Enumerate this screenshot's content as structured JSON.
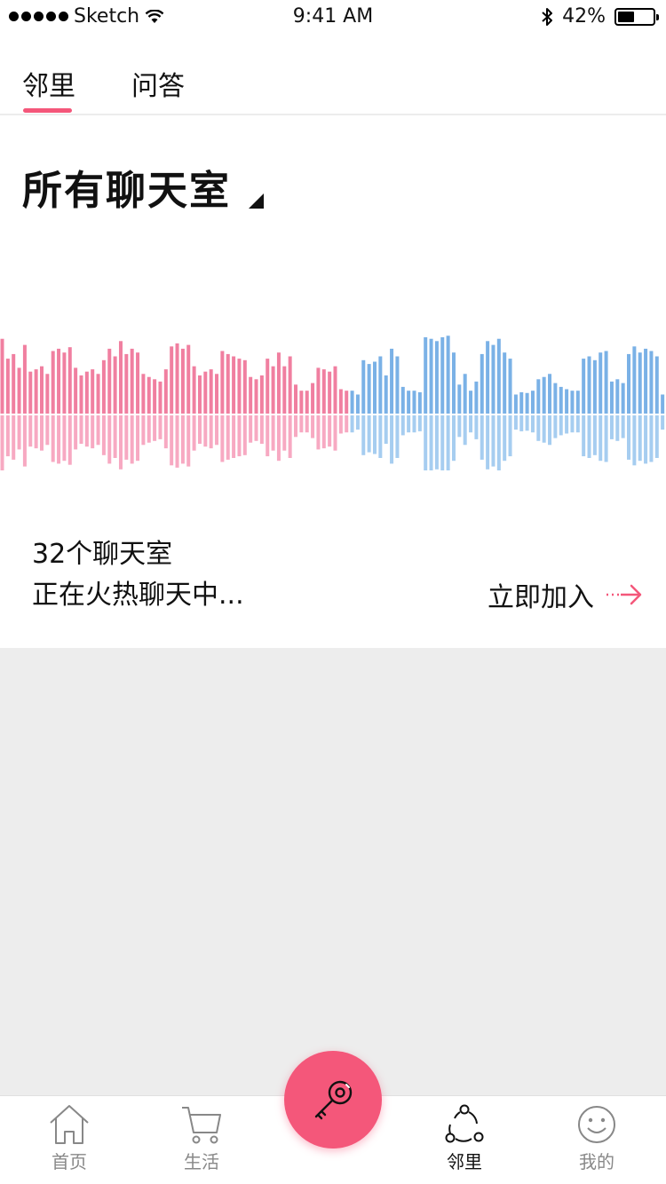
{
  "status_bar": {
    "carrier": "Sketch",
    "time": "9:41 AM",
    "battery": "42%",
    "battery_level": 0.42
  },
  "top_tabs": [
    {
      "label": "邻里",
      "active": true
    },
    {
      "label": "问答",
      "active": false
    }
  ],
  "section": {
    "title": "所有聊天室",
    "room_count": "32个聊天室",
    "status": "正在火热聊天中...",
    "join_label": "立即加入"
  },
  "waveform": {
    "colors": {
      "left_top": "#f07fa0",
      "left_bottom": "#f7a9c2",
      "right_top": "#7ab1e6",
      "right_bottom": "#a6cdf0",
      "divider": "#ffffff"
    },
    "amplitudes": [
      0.98,
      0.72,
      0.78,
      0.6,
      0.9,
      0.55,
      0.58,
      0.62,
      0.52,
      0.82,
      0.85,
      0.8,
      0.87,
      0.6,
      0.5,
      0.55,
      0.58,
      0.52,
      0.7,
      0.85,
      0.75,
      0.95,
      0.78,
      0.85,
      0.8,
      0.52,
      0.48,
      0.45,
      0.42,
      0.58,
      0.88,
      0.92,
      0.85,
      0.9,
      0.62,
      0.5,
      0.55,
      0.58,
      0.52,
      0.82,
      0.78,
      0.75,
      0.72,
      0.7,
      0.48,
      0.45,
      0.5,
      0.72,
      0.62,
      0.8,
      0.62,
      0.75,
      0.38,
      0.3,
      0.3,
      0.4,
      0.6,
      0.58,
      0.55,
      0.62,
      0.32,
      0.3,
      0.3,
      0.25,
      0.7,
      0.65,
      0.68,
      0.75,
      0.5,
      0.85,
      0.75,
      0.35,
      0.3,
      0.3,
      0.28,
      1.0,
      0.98,
      0.95,
      1.0,
      1.02,
      0.8,
      0.38,
      0.52,
      0.3,
      0.42,
      0.78,
      0.95,
      0.9,
      0.98,
      0.8,
      0.72,
      0.25,
      0.28,
      0.27,
      0.3,
      0.45,
      0.48,
      0.52,
      0.4,
      0.35,
      0.32,
      0.3,
      0.3,
      0.72,
      0.75,
      0.7,
      0.8,
      0.82,
      0.42,
      0.45,
      0.4,
      0.78,
      0.88,
      0.8,
      0.85,
      0.82,
      0.75,
      0.25
    ],
    "split_index": 62
  },
  "bottom_nav": {
    "items": [
      {
        "label": "首页",
        "icon": "home-icon",
        "active": false
      },
      {
        "label": "生活",
        "icon": "cart-icon",
        "active": false
      },
      {
        "label": "邻里",
        "icon": "share-nodes-icon",
        "active": true
      },
      {
        "label": "我的",
        "icon": "smile-icon",
        "active": false
      }
    ],
    "center_button_icon": "key-icon",
    "accent": "#f4577a"
  }
}
